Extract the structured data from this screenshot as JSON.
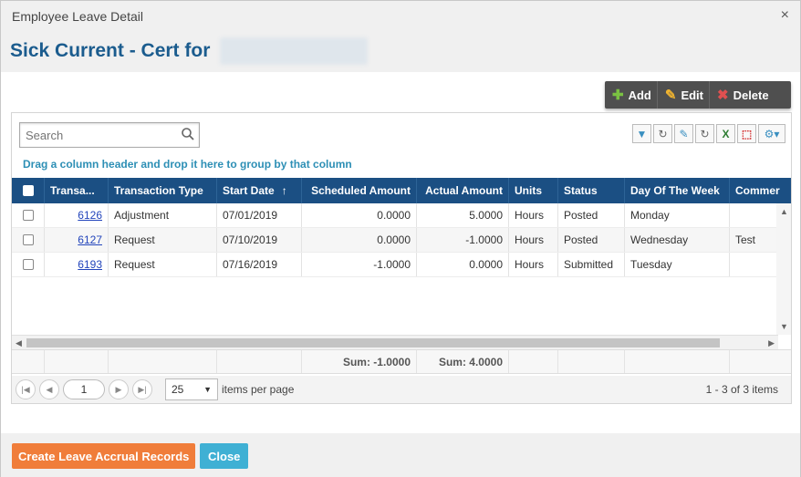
{
  "window": {
    "title": "Employee Leave Detail",
    "close_glyph": "×"
  },
  "heading": {
    "text": "Sick Current - Cert for"
  },
  "toolbar": {
    "add": "Add",
    "edit": "Edit",
    "delete": "Delete"
  },
  "search": {
    "placeholder": "Search"
  },
  "grid": {
    "group_hint": "Drag a column header and drop it here to group by that column",
    "columns": [
      "Transa...",
      "Transaction Type",
      "Start Date",
      "Scheduled Amount",
      "Actual Amount",
      "Units",
      "Status",
      "Day Of The Week",
      "Commer"
    ],
    "sort_indicator": "↑",
    "rows": [
      {
        "id": "6126",
        "type": "Adjustment",
        "start": "07/01/2019",
        "scheduled": "0.0000",
        "actual": "5.0000",
        "units": "Hours",
        "status": "Posted",
        "day": "Monday",
        "comment": ""
      },
      {
        "id": "6127",
        "type": "Request",
        "start": "07/10/2019",
        "scheduled": "0.0000",
        "actual": "-1.0000",
        "units": "Hours",
        "status": "Posted",
        "day": "Wednesday",
        "comment": "Test"
      },
      {
        "id": "6193",
        "type": "Request",
        "start": "07/16/2019",
        "scheduled": "-1.0000",
        "actual": "0.0000",
        "units": "Hours",
        "status": "Submitted",
        "day": "Tuesday",
        "comment": ""
      }
    ],
    "footer": {
      "scheduled_sum": "Sum: -1.0000",
      "actual_sum": "Sum: 4.0000"
    }
  },
  "pager": {
    "page": "1",
    "page_size": "25",
    "per_page_label": "items per page",
    "info": "1 - 3 of 3 items"
  },
  "buttons": {
    "create": "Create Leave Accrual Records",
    "close": "Close"
  },
  "colors": {
    "header_bg": "#1b4f83",
    "title_blue": "#1b5c8e",
    "orange": "#f07d3a",
    "cyan": "#3fb0d4"
  }
}
